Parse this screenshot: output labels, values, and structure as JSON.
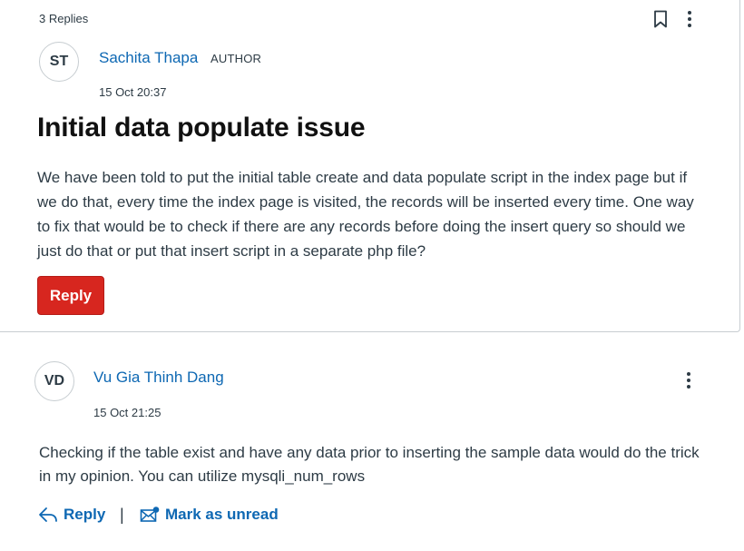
{
  "topic": {
    "replies_count": "3 Replies",
    "author": {
      "initials": "ST",
      "name": "Sachita Thapa",
      "badge": "AUTHOR"
    },
    "timestamp": "15 Oct 20:37",
    "title": "Initial data populate issue",
    "body": "We have been told to put the initial table create and data populate script in the index page but if we do that, every time the index page is visited, the records will be inserted every time. One way to fix that would be to check if there are any records before doing the insert query so should we just do that or put that insert script in a separate php file?",
    "reply_button_label": "Reply",
    "icons": {
      "bookmark": "bookmark-icon",
      "menu": "kebab-menu-icon"
    }
  },
  "reply": {
    "author": {
      "initials": "VD",
      "name": "Vu Gia Thinh Dang"
    },
    "timestamp": "15 Oct 21:25",
    "body": "Checking if the table exist and have any data prior to inserting the sample data would do the trick in my opinion. You can utilize mysqli_num_rows",
    "actions": {
      "reply_label": "Reply",
      "separator": "|",
      "mark_unread_label": "Mark as unread"
    },
    "icons": {
      "reply": "reply-arrow-icon",
      "mark_unread": "mail-unread-icon",
      "menu": "kebab-menu-icon"
    }
  },
  "colors": {
    "link": "#0e68b3",
    "reply_button": "#d7261f",
    "text": "#2d3b45",
    "border": "#c7cdd1"
  }
}
